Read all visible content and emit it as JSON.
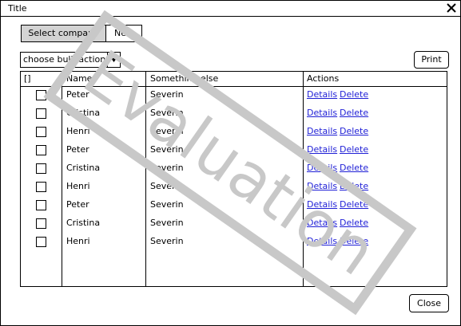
{
  "window": {
    "title": "Title"
  },
  "toolbar": {
    "segment_selected": "Select company",
    "segment_other": "New"
  },
  "bulk_action": {
    "value": "choose bulk action"
  },
  "print_label": "Print",
  "close_label": "Close",
  "watermark": "Evaluation",
  "table": {
    "headers": {
      "select": "[]",
      "name": "Name",
      "something": "Something else",
      "actions": "Actions"
    },
    "action_details": "Details",
    "action_delete": "Delete",
    "rows": [
      {
        "name": "Peter",
        "other": "Severin"
      },
      {
        "name": "Cristina",
        "other": "Severin"
      },
      {
        "name": "Henri",
        "other": "Severin"
      },
      {
        "name": "Peter",
        "other": "Severin"
      },
      {
        "name": "Cristina",
        "other": "Severin"
      },
      {
        "name": "Henri",
        "other": "Severin"
      },
      {
        "name": "Peter",
        "other": "Severin"
      },
      {
        "name": "Cristina",
        "other": "Severin"
      },
      {
        "name": "Henri",
        "other": "Severin"
      }
    ]
  },
  "colors": {
    "link": "#1f1fd6",
    "segment_selected_bg": "#d3d3d3",
    "watermark": "#c8c8c8"
  }
}
